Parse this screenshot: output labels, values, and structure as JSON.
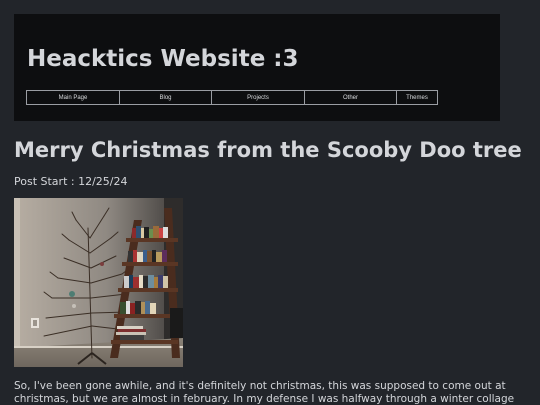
{
  "site": {
    "title": "Heacktics Website :3"
  },
  "nav": {
    "items": [
      {
        "label": "Main Page"
      },
      {
        "label": "Blog"
      },
      {
        "label": "Projects"
      },
      {
        "label": "Other"
      },
      {
        "label": "Themes"
      }
    ]
  },
  "post": {
    "title": "Merry Christmas from the Scooby Doo tree",
    "date": "Post Start : 12/25/24",
    "image": "photo of a bare white twig christmas tree beside a wooden leaning bookshelf",
    "body": "So, I've been gone awhile, and it's definitely not christmas, this was supposed to come out at christmas, but we are almost in february. In my defense I was halfway through a winter collage"
  },
  "colors": {
    "page_background": "#22252a",
    "header_background": "#0d0e10",
    "text": "#d4d6da",
    "nav_border": "#9a9da3"
  }
}
